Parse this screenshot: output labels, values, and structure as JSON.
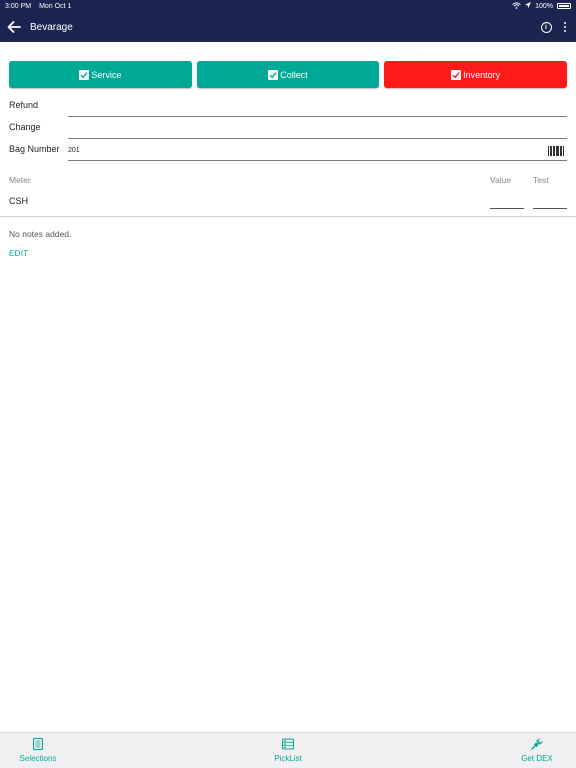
{
  "status_bar": {
    "time": "3:00 PM",
    "date": "Mon Oct 1",
    "battery": "100%"
  },
  "header": {
    "title": "Bevarage"
  },
  "tabs": [
    {
      "label": "Service",
      "color": "#00a896"
    },
    {
      "label": "Collect",
      "color": "#00a896"
    },
    {
      "label": "Inventory",
      "color": "#ff1a1a"
    }
  ],
  "form": {
    "refund_label": "Refund",
    "refund_value": "",
    "change_label": "Change",
    "change_value": "",
    "bag_label": "Bag Number",
    "bag_value": "201"
  },
  "meters": {
    "headers": {
      "meter": "Meter",
      "value": "Value",
      "test": "Test"
    },
    "rows": [
      {
        "name": "CSH",
        "value": "",
        "test": ""
      }
    ]
  },
  "notes": {
    "text": "No notes added.",
    "edit_label": "EDIT"
  },
  "bottom_nav": {
    "selections": "Selections",
    "picklist": "PickList",
    "getdex": "Get DEX"
  },
  "colors": {
    "app_bar": "#1c2450",
    "accent": "#00a896",
    "danger": "#ff1a1a"
  }
}
